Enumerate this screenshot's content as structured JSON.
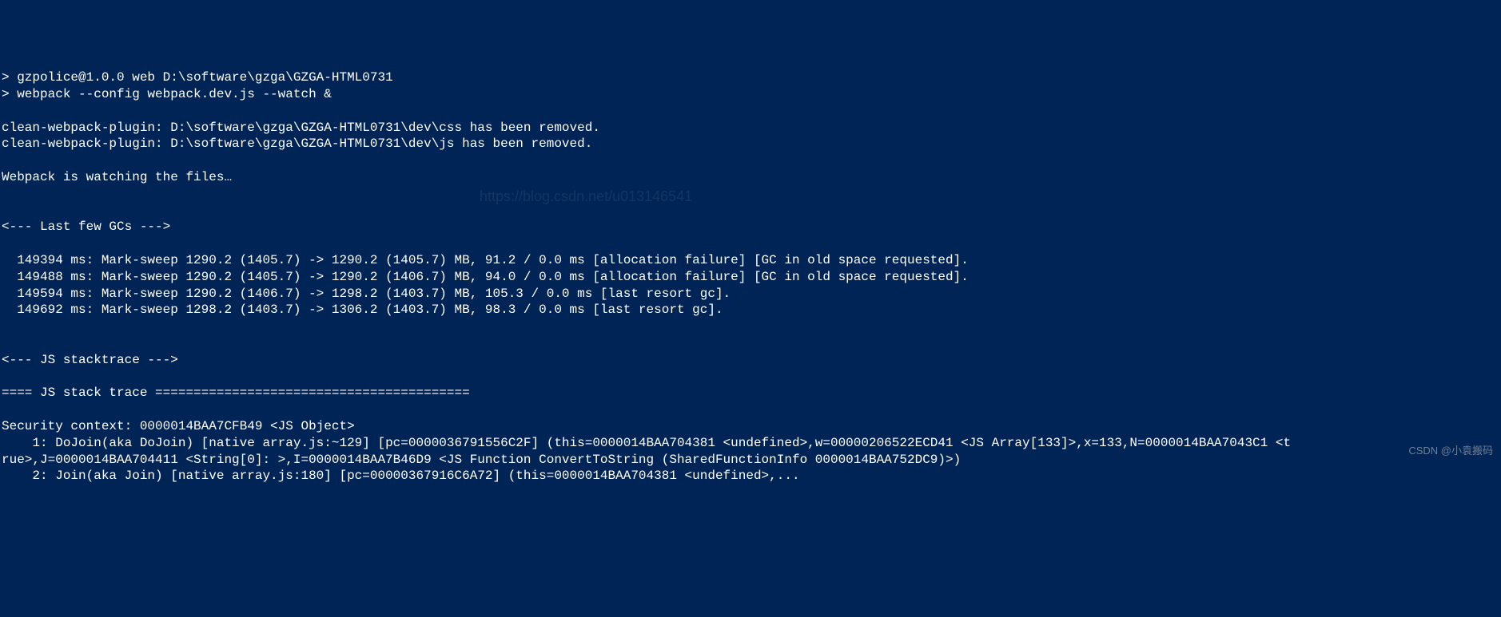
{
  "terminal": {
    "lines": [
      "> gzpolice@1.0.0 web D:\\software\\gzga\\GZGA-HTML0731",
      "> webpack --config webpack.dev.js --watch &",
      "",
      "clean-webpack-plugin: D:\\software\\gzga\\GZGA-HTML0731\\dev\\css has been removed.",
      "clean-webpack-plugin: D:\\software\\gzga\\GZGA-HTML0731\\dev\\js has been removed.",
      "",
      "Webpack is watching the files…",
      "",
      "",
      "<--- Last few GCs --->",
      "",
      "  149394 ms: Mark-sweep 1290.2 (1405.7) -> 1290.2 (1405.7) MB, 91.2 / 0.0 ms [allocation failure] [GC in old space requested].",
      "  149488 ms: Mark-sweep 1290.2 (1405.7) -> 1290.2 (1406.7) MB, 94.0 / 0.0 ms [allocation failure] [GC in old space requested].",
      "  149594 ms: Mark-sweep 1290.2 (1406.7) -> 1298.2 (1403.7) MB, 105.3 / 0.0 ms [last resort gc].",
      "  149692 ms: Mark-sweep 1298.2 (1403.7) -> 1306.2 (1403.7) MB, 98.3 / 0.0 ms [last resort gc].",
      "",
      "",
      "<--- JS stacktrace --->",
      "",
      "==== JS stack trace =========================================",
      "",
      "Security context: 0000014BAA7CFB49 <JS Object>",
      "    1: DoJoin(aka DoJoin) [native array.js:~129] [pc=0000036791556C2F] (this=0000014BAA704381 <undefined>,w=00000206522ECD41 <JS Array[133]>,x=133,N=0000014BAA7043C1 <t",
      "rue>,J=0000014BAA704411 <String[0]: >,I=0000014BAA7B46D9 <JS Function ConvertToString (SharedFunctionInfo 0000014BAA752DC9)>)",
      "    2: Join(aka Join) [native array.js:180] [pc=00000367916C6A72] (this=0000014BAA704381 <undefined>,..."
    ]
  },
  "watermarks": {
    "blog": "https://blog.csdn.net/u013146541",
    "csdn": "CSDN @小袁搬码"
  }
}
